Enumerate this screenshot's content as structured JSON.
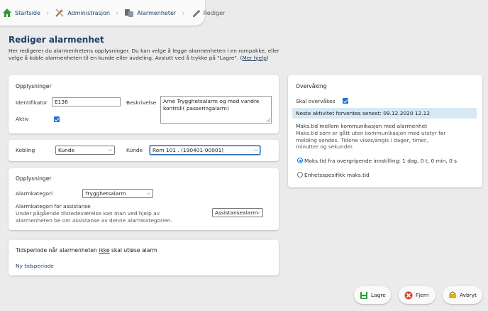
{
  "breadcrumb": {
    "items": [
      {
        "label": "Startside",
        "icon": "home-icon"
      },
      {
        "label": "Administrasjon",
        "icon": "tools-icon"
      },
      {
        "label": "Alarmenheter",
        "icon": "devices-icon"
      },
      {
        "label": "Rediger",
        "icon": "edit-icon"
      }
    ]
  },
  "page": {
    "title": "Rediger alarmenhet",
    "intro": "Her redigerer du alarmenhetens opplysninger. Du kan velge å legge alarmenheten i en rompakke, eller velge å koble alarmenheten til en kunde eller avdeling. Avslutt ved å trykke på \"Lagre\".",
    "help_link": "Mer hjelp"
  },
  "info_panel": {
    "title": "Opplysninger",
    "identifier_label": "Identifikator",
    "identifier_value": "E136",
    "description_label": "Beskrivelse",
    "description_value": "Arne Trygghetsalarm og med vandre kontroll( passeringalarm)",
    "active_label": "Aktiv",
    "active_checked": true
  },
  "link_panel": {
    "kobling_label": "Kobling",
    "kobling_value": "Kunde",
    "kunde_label": "Kunde",
    "kunde_value": "Rom 101 . (190401-00001)"
  },
  "category_panel": {
    "title": "Opplysninger",
    "category_label": "Alarmkategori",
    "category_value": "Trygghetsalarm",
    "assist_title": "Alarmkategori for assistanse",
    "assist_desc": "Under pågående tilstedeværelse kan man ved hjelp av alarmenheten be om assistanse av denne alarmkategorien.",
    "assist_value": "Assistansealarm"
  },
  "period_panel": {
    "title_pre": "Tidsperiode når alarmenheten",
    "title_em": "ikke",
    "title_post": "skal utløse alarm",
    "new_link": "Ny tidsperiode"
  },
  "monitor_panel": {
    "title": "Overvåking",
    "monitor_label": "Skal overvåkes",
    "monitor_checked": true,
    "next_activity": "Neste aktivitet forventes senest: 09.12.2020 12.12",
    "max_title": "Maks.tid mellom kommunikasjon med alarmenhet",
    "max_desc": "Maks.tid som er gått uten kommunikasjon med utstyr før melding sendes. Tidene vises/angis i dager, timer, minutter og sekunder.",
    "option_inherit": "Maks.tid fra overgripende innstilling: 1 dag, 0 t, 0 min, 0 s",
    "option_inherit_selected": true,
    "option_specific": "Enhetsspesifikk maks.tid"
  },
  "actions": {
    "save": "Lagre",
    "remove": "Fjern",
    "cancel": "Avbryt"
  },
  "colors": {
    "title": "#1f3f66",
    "accent": "#1a73e8",
    "info_strip": "#d6e9f5",
    "background": "#ebebeb"
  }
}
